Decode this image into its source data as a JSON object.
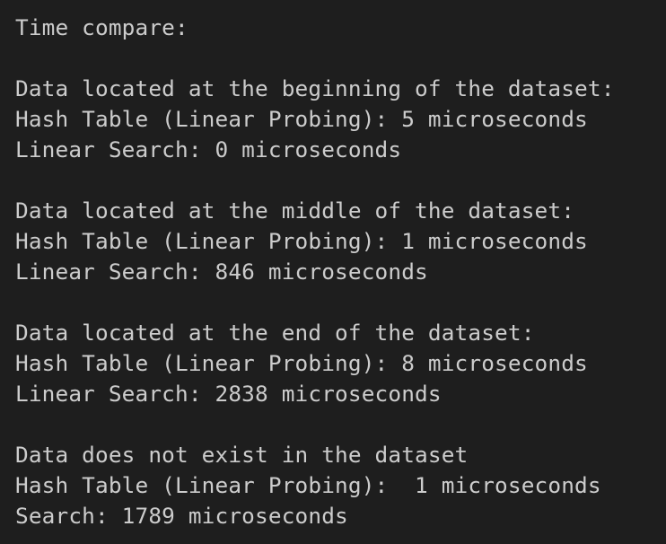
{
  "terminal": {
    "lines": [
      "Time compare:",
      "",
      "Data located at the beginning of the dataset:",
      "Hash Table (Linear Probing): 5 microseconds",
      "Linear Search: 0 microseconds",
      "",
      "Data located at the middle of the dataset:",
      "Hash Table (Linear Probing): 1 microseconds",
      "Linear Search: 846 microseconds",
      "",
      "Data located at the end of the dataset:",
      "Hash Table (Linear Probing): 8 microseconds",
      "Linear Search: 2838 microseconds",
      "",
      "Data does not exist in the dataset",
      "Hash Table (Linear Probing):  1 microseconds",
      "Search: 1789 microseconds"
    ]
  },
  "colors": {
    "background": "#1e1e1e",
    "text": "#cccccc"
  }
}
